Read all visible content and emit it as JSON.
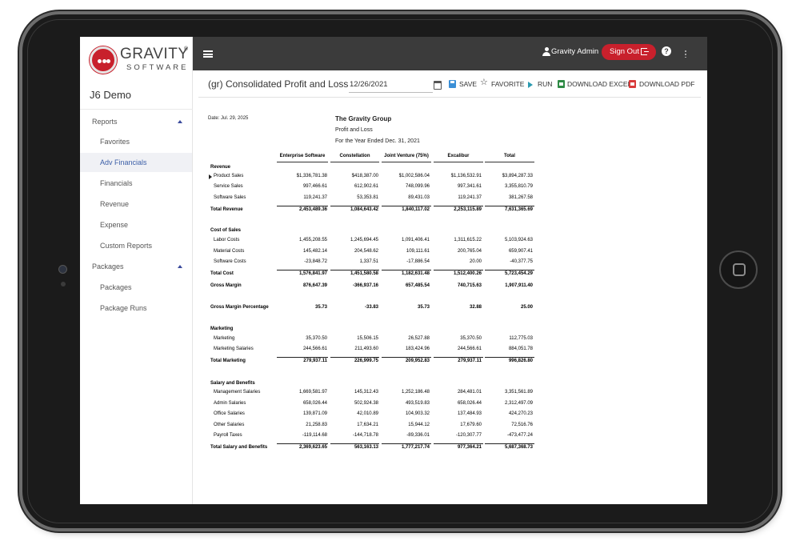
{
  "brand": {
    "logo_word": "GRAVITY",
    "logo_reg": "®",
    "logo_sub": "SOFTWARE",
    "accent": "#c8202c"
  },
  "sidebar": {
    "company": "J6 Demo",
    "sections": [
      {
        "label": "Reports",
        "items": [
          "Favorites",
          "Adv Financials",
          "Financials",
          "Revenue",
          "Expense",
          "Custom Reports"
        ]
      },
      {
        "label": "Packages",
        "items": [
          "Packages",
          "Package Runs"
        ]
      }
    ],
    "active_item": "Adv Financials"
  },
  "topbar": {
    "user": "Gravity Admin",
    "signout": "Sign Out",
    "help": "?"
  },
  "report_header": {
    "title": "(gr) Consolidated Profit and Loss",
    "date_value": "12/26/2021",
    "actions": {
      "save": "SAVE",
      "favorite": "FAVORITE",
      "run": "RUN",
      "excel": "DOWNLOAD EXCEL",
      "pdf": "DOWNLOAD PDF"
    }
  },
  "report": {
    "date": "Date: Jul. 29, 2025",
    "company": "The Gravity Group",
    "subtitle": "Profit and Loss",
    "period": "For the Year Ended Dec. 31, 2021",
    "columns": [
      "Enterprise Software",
      "Constellation",
      "Joint Venture (75%)",
      "Excalibur",
      "Total"
    ],
    "sections": {
      "revenue": "Revenue",
      "cost": "Cost of Sales",
      "marketing": "Marketing",
      "salary": "Salary and Benefits"
    },
    "rows": [
      {
        "label": "Product Sales",
        "values": [
          "$1,336,781.38",
          "$418,387.00",
          "$1,002,586.04",
          "$1,136,532.91",
          "$3,894,287.33"
        ]
      },
      {
        "label": "Service Sales",
        "values": [
          "997,466.61",
          "612,902.61",
          "748,099.96",
          "997,341.61",
          "3,355,810.79"
        ]
      },
      {
        "label": "Software Sales",
        "values": [
          "119,241.37",
          "53,353.81",
          "89,431.03",
          "119,241.37",
          "381,267.58"
        ]
      },
      {
        "label": "Total Revenue",
        "values": [
          "2,453,489.36",
          "1,084,643.42",
          "1,840,117.02",
          "2,253,115.89",
          "7,631,365.69"
        ]
      },
      {
        "label": "Labor Costs",
        "values": [
          "1,455,208.55",
          "1,245,694.45",
          "1,091,406.41",
          "1,311,615.22",
          "5,103,924.63"
        ]
      },
      {
        "label": "Material Costs",
        "values": [
          "145,482.14",
          "204,548.62",
          "109,111.61",
          "200,765.04",
          "659,907.41"
        ]
      },
      {
        "label": "Software Costs",
        "values": [
          "-23,848.72",
          "1,337.51",
          "-17,886.54",
          "20.00",
          "-40,377.75"
        ]
      },
      {
        "label": "Total Cost",
        "values": [
          "1,576,841.97",
          "1,451,580.58",
          "1,182,631.48",
          "1,512,400.26",
          "5,723,454.29"
        ]
      },
      {
        "label": "Gross Margin",
        "values": [
          "876,647.39",
          "-366,937.16",
          "657,485.54",
          "740,715.63",
          "1,907,911.40"
        ]
      },
      {
        "label": "Gross Margin Percentage",
        "values": [
          "35.73",
          "-33.83",
          "35.73",
          "32.88",
          "25.00"
        ]
      },
      {
        "label": "Marketing",
        "values": [
          "35,370.50",
          "15,506.15",
          "26,527.88",
          "35,370.50",
          "112,775.03"
        ]
      },
      {
        "label": "Marketing Salaries",
        "values": [
          "244,566.61",
          "211,493.60",
          "183,424.96",
          "244,566.61",
          "884,051.78"
        ]
      },
      {
        "label": "Total Marketing",
        "values": [
          "279,937.11",
          "226,999.75",
          "209,952.83",
          "279,937.11",
          "996,826.80"
        ]
      },
      {
        "label": "Management Salaries",
        "values": [
          "1,669,581.97",
          "145,312.43",
          "1,252,186.48",
          "284,481.01",
          "3,351,561.89"
        ]
      },
      {
        "label": "Admin Salaries",
        "values": [
          "658,026.44",
          "502,924.38",
          "493,519.83",
          "658,026.44",
          "2,312,497.09"
        ]
      },
      {
        "label": "Office Salaries",
        "values": [
          "139,871.09",
          "42,010.89",
          "104,903.32",
          "137,484.93",
          "424,270.23"
        ]
      },
      {
        "label": "Other Salaries",
        "values": [
          "21,258.83",
          "17,634.21",
          "15,944.12",
          "17,679.60",
          "72,516.76"
        ]
      },
      {
        "label": "Payroll Taxes",
        "values": [
          "-119,114.68",
          "-144,718.78",
          "-89,336.01",
          "-120,307.77",
          "-473,477.24"
        ]
      },
      {
        "label": "Total Salary and Benefits",
        "values": [
          "2,369,623.65",
          "563,163.13",
          "1,777,217.74",
          "977,364.21",
          "5,687,368.73"
        ]
      }
    ]
  }
}
